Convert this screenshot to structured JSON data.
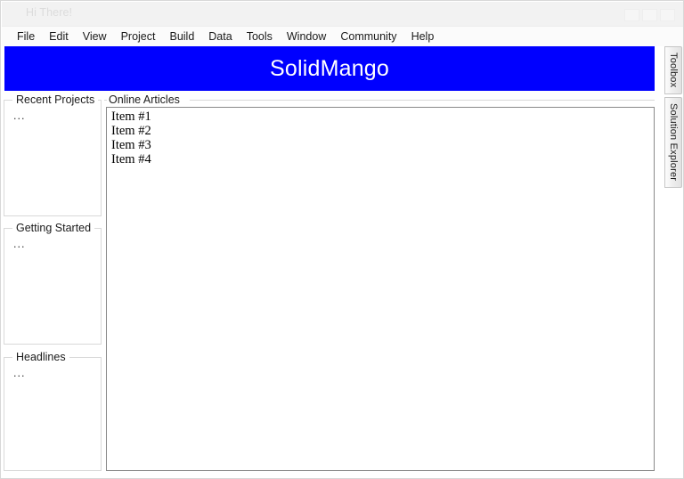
{
  "window": {
    "title": "Hi There!",
    "controls": [
      {
        "name": "minimize-button",
        "glyph": ""
      },
      {
        "name": "maximize-button",
        "glyph": ""
      },
      {
        "name": "close-button",
        "glyph": ""
      }
    ]
  },
  "menu": {
    "items": [
      {
        "label": "File"
      },
      {
        "label": "Edit"
      },
      {
        "label": "View"
      },
      {
        "label": "Project"
      },
      {
        "label": "Build"
      },
      {
        "label": "Data"
      },
      {
        "label": "Tools"
      },
      {
        "label": "Window"
      },
      {
        "label": "Community"
      },
      {
        "label": "Help"
      }
    ]
  },
  "banner": {
    "title": "SolidMango",
    "background_color": "#0000FF",
    "text_color": "#FFFFFF"
  },
  "dock_tabs": [
    {
      "label": "Toolbox"
    },
    {
      "label": "Solution Explorer"
    }
  ],
  "sidebar": {
    "groups": [
      {
        "label": "Recent Projects",
        "content": "..."
      },
      {
        "label": "Getting Started",
        "content": "..."
      },
      {
        "label": "Headlines",
        "content": "..."
      }
    ]
  },
  "main": {
    "group_label": "Online Articles",
    "items": [
      {
        "label": "Item #1"
      },
      {
        "label": "Item #2"
      },
      {
        "label": "Item #3"
      },
      {
        "label": "Item #4"
      }
    ]
  }
}
